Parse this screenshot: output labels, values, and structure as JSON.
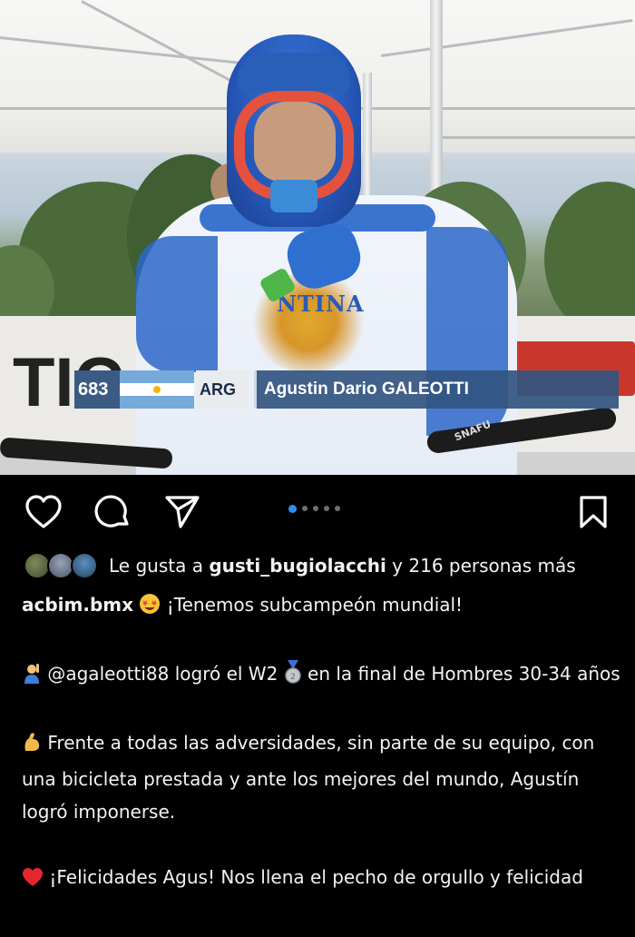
{
  "overlay": {
    "bib_number": "683",
    "country_code": "ARG",
    "rider_name": "Agustin Dario GALEOTTI"
  },
  "photo_scene": {
    "chest_text": "NTINA",
    "banner_left": "TIC",
    "bar_brand": "SNAFU"
  },
  "actions": {
    "like_icon": "heart-icon",
    "comment_icon": "comment-icon",
    "share_icon": "send-icon",
    "save_icon": "bookmark-icon",
    "carousel_count": 5,
    "carousel_active": 1
  },
  "likes": {
    "prefix": "Le gusta a ",
    "user": "gusti_bugiolacchi",
    "suffix": " y 216 personas más"
  },
  "caption": {
    "username": "acbim.bmx",
    "line1_text": " ¡Tenemos subcampeón mundial!",
    "para2": " @agaleotti88 logró el W2 ",
    "para2_end": " en la final de Hombres 30-34 años",
    "para3": " Frente a todas las adversidades, sin parte de su equipo, con una bicicleta prestada y ante los mejores del mundo, Agustín logró imponerse.",
    "para4": " ¡Felicidades Agus! Nos llena el pecho de orgullo y felicidad"
  },
  "colors": {
    "background": "#000000",
    "accent_dot": "#2e8df5",
    "argentina_blue": "#75aadb"
  }
}
